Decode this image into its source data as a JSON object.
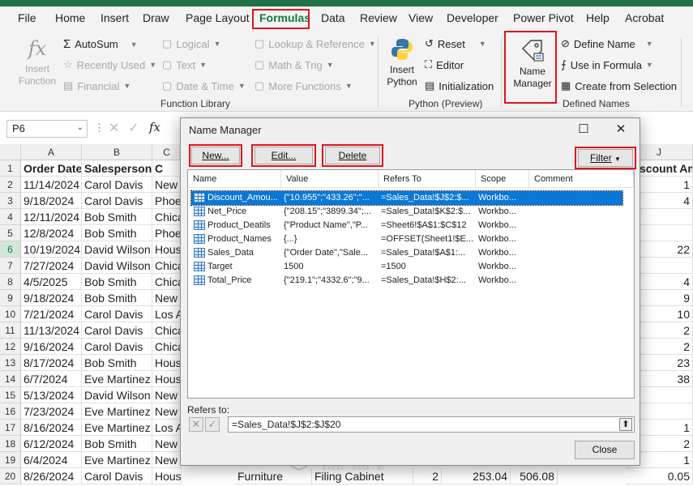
{
  "menu": {
    "tabs": [
      "File",
      "Home",
      "Insert",
      "Draw",
      "Page Layout",
      "Formulas",
      "Data",
      "Review",
      "View",
      "Developer",
      "Power Pivot",
      "Help",
      "Acrobat"
    ]
  },
  "ribbon": {
    "insert_function": [
      "Insert",
      "Function"
    ],
    "autosum": "AutoSum",
    "recently_used": "Recently Used",
    "financial": "Financial",
    "logical": "Logical",
    "text": "Text",
    "date_time": "Date & Time",
    "lookup_reference": "Lookup & Reference",
    "math_trig": "Math & Trig",
    "more_functions": "More Functions",
    "function_library_label": "Function Library",
    "insert_python": [
      "Insert",
      "Python"
    ],
    "reset": "Reset",
    "editor": "Editor",
    "initialization": "Initialization",
    "python_preview_label": "Python (Preview)",
    "name_manager": [
      "Name",
      "Manager"
    ],
    "define_name": "Define Name",
    "use_in_formula": "Use in Formula",
    "create_from_selection": "Create from Selection",
    "defined_names_label": "Defined Names"
  },
  "formula_bar": {
    "name_box": "P6",
    "fx": "fx"
  },
  "sheet": {
    "columns": [
      "A",
      "B",
      "C",
      "J"
    ],
    "headers": [
      "Order Date",
      "Salesperson",
      "C",
      "Discount Am"
    ],
    "rows": [
      {
        "n": "1"
      },
      {
        "n": "2",
        "date": "11/14/2024",
        "person": "Carol Davis",
        "city": "New",
        "j": "1"
      },
      {
        "n": "3",
        "date": "9/18/2024",
        "person": "Carol Davis",
        "city": "Phoe",
        "j": "4"
      },
      {
        "n": "4",
        "date": "12/11/2024",
        "person": "Bob Smith",
        "city": "Chica",
        "j": ""
      },
      {
        "n": "5",
        "date": "12/8/2024",
        "person": "Bob Smith",
        "city": "Phoe",
        "j": ""
      },
      {
        "n": "6",
        "date": "10/19/2024",
        "person": "David Wilson",
        "city": "Hous",
        "j": "22"
      },
      {
        "n": "7",
        "date": "7/27/2024",
        "person": "David Wilson",
        "city": "Chica",
        "j": ""
      },
      {
        "n": "8",
        "date": "4/5/2025",
        "person": "Bob Smith",
        "city": "Chica",
        "j": "4"
      },
      {
        "n": "9",
        "date": "9/18/2024",
        "person": "Bob Smith",
        "city": "New",
        "j": "9"
      },
      {
        "n": "10",
        "date": "7/21/2024",
        "person": "Carol Davis",
        "city": "Los A",
        "j": "10"
      },
      {
        "n": "11",
        "date": "11/13/2024",
        "person": "Carol Davis",
        "city": "Chica",
        "j": "2"
      },
      {
        "n": "12",
        "date": "9/16/2024",
        "person": "Carol Davis",
        "city": "Chica",
        "j": "2"
      },
      {
        "n": "13",
        "date": "8/17/2024",
        "person": "Bob Smith",
        "city": "Hous",
        "j": "23"
      },
      {
        "n": "14",
        "date": "6/7/2024",
        "person": "Eve Martinez",
        "city": "Hous",
        "j": "38"
      },
      {
        "n": "15",
        "date": "5/13/2024",
        "person": "David Wilson",
        "city": "New",
        "j": ""
      },
      {
        "n": "16",
        "date": "7/23/2024",
        "person": "Eve Martinez",
        "city": "New",
        "j": ""
      },
      {
        "n": "17",
        "date": "8/16/2024",
        "person": "Eve Martinez",
        "city": "Los A",
        "j": "1"
      },
      {
        "n": "18",
        "date": "6/12/2024",
        "person": "Bob Smith",
        "city": "New",
        "j": "2"
      },
      {
        "n": "19",
        "date": "6/4/2024",
        "person": "Eve Martinez",
        "city": "New",
        "j": "1"
      },
      {
        "n": "20",
        "date": "8/26/2024",
        "person": "Carol Davis",
        "city": "Houston",
        "j": "0.05"
      }
    ],
    "row20_extra": {
      "d": "Furniture",
      "e": "Filing Cabinet",
      "f": "2",
      "g": "253.04",
      "h": "506.08"
    }
  },
  "dialog": {
    "title": "Name Manager",
    "buttons": {
      "new": "New...",
      "edit": "Edit...",
      "delete": "Delete",
      "filter": "Filter",
      "close": "Close"
    },
    "columns": [
      "Name",
      "Value",
      "Refers To",
      "Scope",
      "Comment"
    ],
    "names": [
      {
        "name": "Discount_Amou...",
        "value": "{\"10.955\";\"433.26\";\"...",
        "refers": "=Sales_Data!$J$2:$...",
        "scope": "Workbo...",
        "selected": true
      },
      {
        "name": "Net_Price",
        "value": "{\"208.15\";\"3899.34\";...",
        "refers": "=Sales_Data!$K$2:$...",
        "scope": "Workbo..."
      },
      {
        "name": "Product_Deatils",
        "value": "{\"Product Name\",\"P...",
        "refers": "=Sheet6!$A$1:$C$12",
        "scope": "Workbo..."
      },
      {
        "name": "Product_Names",
        "value": "{...}",
        "refers": "=OFFSET(Sheet1!$E...",
        "scope": "Workbo..."
      },
      {
        "name": "Sales_Data",
        "value": "{\"Order Date\",\"Sale...",
        "refers": "=Sales_Data!$A$1:...",
        "scope": "Workbo..."
      },
      {
        "name": "Target",
        "value": "1500",
        "refers": "=1500",
        "scope": "Workbo..."
      },
      {
        "name": "Total_Price",
        "value": "{\"219.1\";\"4332.6\";\"9...",
        "refers": "=Sales_Data!$H$2:...",
        "scope": "Workbo..."
      }
    ],
    "refers_to_label": "Refers to:",
    "refers_to_value": "=Sales_Data!$J$2:$J$20"
  },
  "watermark": {
    "brand": "exceldemy",
    "tagline": "EXCEL · DATA · BI"
  }
}
